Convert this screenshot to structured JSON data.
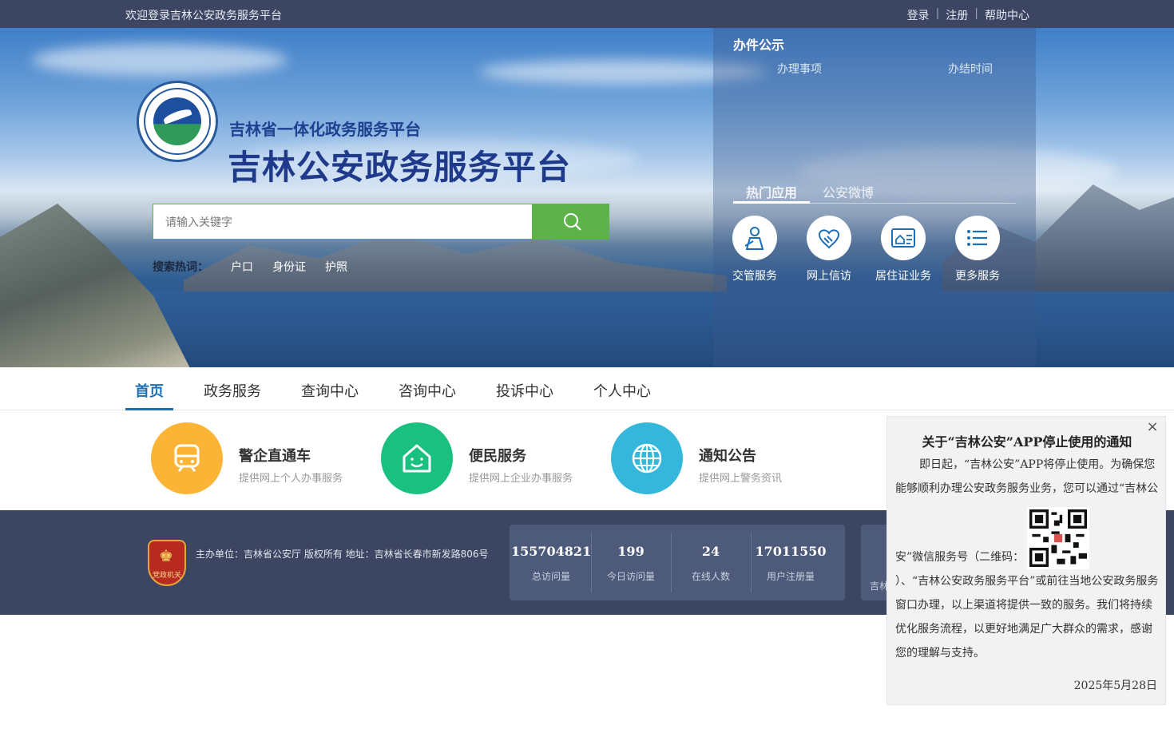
{
  "topbar": {
    "welcome": "欢迎登录吉林公安政务服务平台",
    "login": "登录",
    "register": "注册",
    "help": "帮助中心",
    "separator": "|"
  },
  "header": {
    "subtitle": "吉林省一体化政务服务平台",
    "title": "吉林公安政务服务平台"
  },
  "search": {
    "placeholder": "请输入关键字",
    "hot_label": "搜索热词：",
    "hot_words": [
      "户口",
      "身份证",
      "护照"
    ]
  },
  "panel": {
    "title": "办件公示",
    "col_item": "办理事项",
    "col_time": "办结时间",
    "tabs": [
      "热门应用",
      "公安微博"
    ],
    "apps": [
      {
        "label": "交管服务",
        "icon": "traffic-police-icon"
      },
      {
        "label": "网上信访",
        "icon": "handshake-icon"
      },
      {
        "label": "居住证业务",
        "icon": "house-card-icon"
      },
      {
        "label": "更多服务",
        "icon": "list-icon"
      }
    ]
  },
  "nav": {
    "items": [
      "首页",
      "政务服务",
      "查询中心",
      "咨询中心",
      "投诉中心",
      "个人中心"
    ],
    "active": "首页"
  },
  "services": [
    {
      "name": "警企直通车",
      "desc": "提供网上个人办事服务",
      "icon": "train-icon",
      "color": "#fbb436"
    },
    {
      "name": "便民服务",
      "desc": "提供网上企业办事服务",
      "icon": "smile-house-icon",
      "color": "#19c07f"
    },
    {
      "name": "通知公告",
      "desc": "提供网上警务资讯",
      "icon": "globe-icon",
      "color": "#35b7dc"
    }
  ],
  "footer": {
    "badge_text": "党政机关",
    "info": "主办单位：吉林省公安厅  版权所有 地址：吉林省长春市新发路806号",
    "stats": [
      {
        "value": "155704821",
        "label": "总访问量"
      },
      {
        "value": "199",
        "label": "今日访问量"
      },
      {
        "value": "24",
        "label": "在线人数"
      },
      {
        "value": "17011550",
        "label": "用户注册量"
      }
    ],
    "stats2_partial": "吉林"
  },
  "notice": {
    "close": "×",
    "title": "关于“吉林公安”APP停止使用的通知",
    "p1": "即日起，“吉林公安”APP将停止使用。为确保您能够顺利办理公安政务服务业务，您可以通过“吉林公",
    "qr_prefix": "安”微信服务号（二维码：",
    "p2": "）、“吉林公安政务服务平台”或前往当地公安政务服务窗口办理，以上渠道将提供一致的服务。我们将持续优化服务流程，以更好地满足广大群众的需求，感谢您的理解与支持。",
    "date": "2025年5月28日"
  },
  "colors": {
    "topbar": "#3c4663",
    "accent_green": "#5db34a",
    "nav_active": "#1c6fb5"
  }
}
